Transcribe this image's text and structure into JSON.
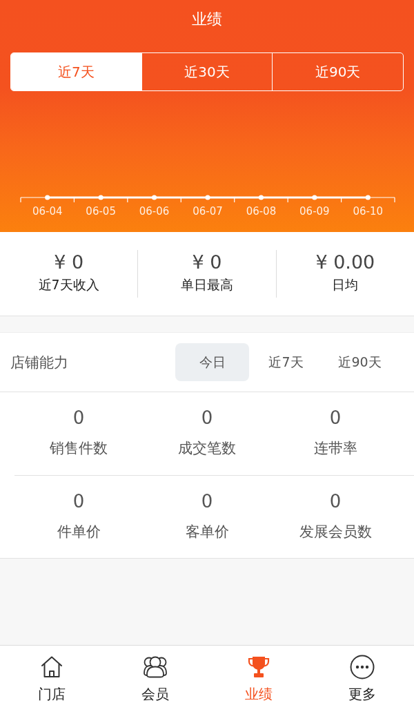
{
  "header": {
    "title": "业绩"
  },
  "range_tabs": [
    {
      "label": "近7天",
      "selected": true
    },
    {
      "label": "近30天",
      "selected": false
    },
    {
      "label": "近90天",
      "selected": false
    }
  ],
  "trend_chart": {
    "date_labels": [
      "06-04",
      "06-05",
      "06-06",
      "06-07",
      "06-08",
      "06-09",
      "06-10"
    ]
  },
  "summary": [
    {
      "value": "¥ 0",
      "label": "近7天收入"
    },
    {
      "value": "¥ 0",
      "label": "单日最高"
    },
    {
      "value": "¥ 0.00",
      "label": "日均"
    }
  ],
  "store_ability": {
    "title": "店铺能力",
    "tabs": [
      {
        "label": "今日",
        "selected": true
      },
      {
        "label": "近7天",
        "selected": false
      },
      {
        "label": "近90天",
        "selected": false
      }
    ],
    "metrics": [
      {
        "value": "0",
        "label": "销售件数"
      },
      {
        "value": "0",
        "label": "成交笔数"
      },
      {
        "value": "0",
        "label": "连带率"
      },
      {
        "value": "0",
        "label": "件单价"
      },
      {
        "value": "0",
        "label": "客单价"
      },
      {
        "value": "0",
        "label": "发展会员数"
      }
    ]
  },
  "bottom_nav": [
    {
      "label": "门店",
      "selected": false
    },
    {
      "label": "会员",
      "selected": false
    },
    {
      "label": "业绩",
      "selected": true
    },
    {
      "label": "更多",
      "selected": false
    }
  ]
}
